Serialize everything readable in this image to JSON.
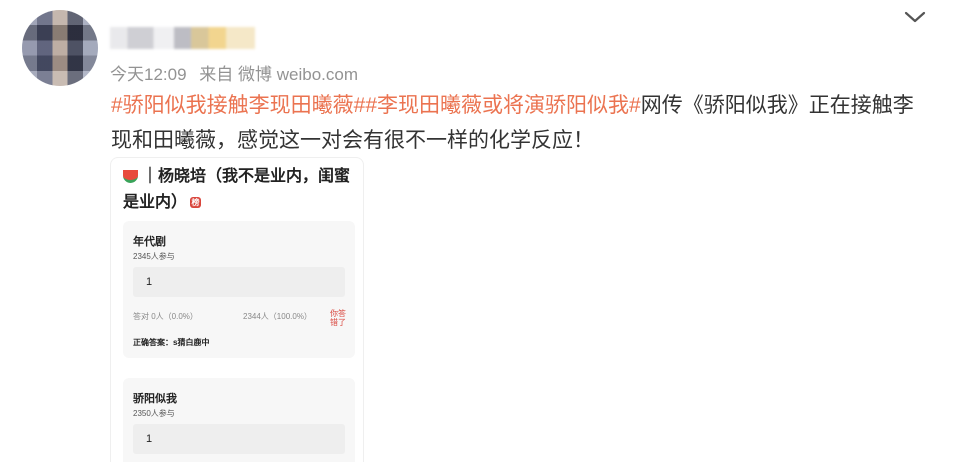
{
  "post": {
    "time": "今天12:09",
    "source": "来自 微博 weibo.com",
    "hashtags": [
      "#骄阳似我接触李现田曦薇#",
      "#李现田曦薇或将演骄阳似我#"
    ],
    "body": "网传《骄阳似我》正在接触李现和田曦薇，感觉这一对会有很不一样的化学反应！"
  },
  "image": {
    "header_title": "｜杨晓培（我不是业内，闺蜜是业内）",
    "badge": "榜",
    "quiz1": {
      "title": "年代剧",
      "participants": "2345人参与",
      "answer_box": "1",
      "left_stat": "答对  0人（0.0%）",
      "right_stat": "2344人（100.0%）",
      "wrong_label": "你答错了",
      "correct_answer": "正确答案：s猜白鹿中"
    },
    "quiz2": {
      "title": "骄阳似我",
      "participants": "2350人参与",
      "answer_box": "1"
    }
  },
  "colors": {
    "hashtag": "#eb7350",
    "meta": "#939393",
    "text": "#333333"
  },
  "icons": {
    "collapse": "chevron-down-icon",
    "avatar": "blurred-avatar"
  }
}
